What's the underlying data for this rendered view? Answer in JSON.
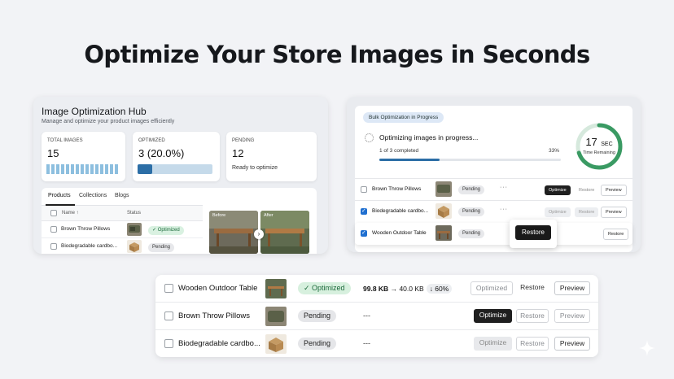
{
  "headline": "Optimize Your Store Images in Seconds",
  "hub": {
    "title": "Image Optimization Hub",
    "subtitle": "Manage and optimize your product images efficiently",
    "stats": [
      {
        "label": "TOTAL IMAGES",
        "value": "15"
      },
      {
        "label": "OPTIMIZED",
        "value": "3 (20.0%)",
        "progress": 0.2
      },
      {
        "label": "PENDING",
        "value": "12",
        "note": "Ready to optimize"
      }
    ],
    "tabs": [
      "Products",
      "Collections",
      "Blogs"
    ],
    "columns": {
      "name": "Name ↑",
      "status": "Status"
    },
    "rows": [
      {
        "name": "Brown Throw Pillows",
        "status": "✓ Optimized",
        "thumb": "pillow"
      },
      {
        "name": "Biodegradable cardbo...",
        "status": "Pending",
        "thumb": "box"
      }
    ],
    "preview": {
      "before": "Before",
      "after": "After"
    }
  },
  "bulk": {
    "badge": "Bulk Optimization in Progress",
    "progress_title": "Optimizing images in progress...",
    "progress_count": "1 of 3 completed",
    "progress_pct_label": "33%",
    "progress": 0.33,
    "timer_value": "17",
    "timer_unit": "SEC",
    "timer_label": "Time Remaining",
    "timer_fraction": 0.7,
    "rows": [
      {
        "name": "Brown Throw Pillows",
        "status": "Pending",
        "dots": "···",
        "primary": "Optimize",
        "secondary": "Restore",
        "tertiary": "Preview"
      },
      {
        "name": "Biodegradable cardbo...",
        "status": "Pending",
        "dots": "···",
        "primary": "Optimize",
        "secondary": "Restore",
        "tertiary": "Preview"
      },
      {
        "name": "Wooden Outdoor Table",
        "status": "Pending",
        "tertiary": "Restore"
      }
    ],
    "popup_button": "Restore"
  },
  "list": {
    "rows": [
      {
        "name": "Wooden Outdoor Table",
        "status": "✓ Optimized",
        "size_from": "99.8 KB",
        "arrow": "→",
        "size_to": "40.0 KB",
        "saving": "↓ 60%",
        "b1": "Optimized",
        "b2": "Restore",
        "b3": "Preview"
      },
      {
        "name": "Brown Throw Pillows",
        "status": "Pending",
        "dash": "---",
        "b1": "Optimize",
        "b2": "Restore",
        "b3": "Preview"
      },
      {
        "name": "Biodegradable cardbo...",
        "status": "Pending",
        "dash": "---",
        "b1": "Optimize",
        "b2": "Restore",
        "b3": "Preview"
      }
    ]
  },
  "colors": {
    "accent": "#2c6ea6",
    "success": "#3a9a63",
    "dark_button": "#1f1f1f"
  }
}
